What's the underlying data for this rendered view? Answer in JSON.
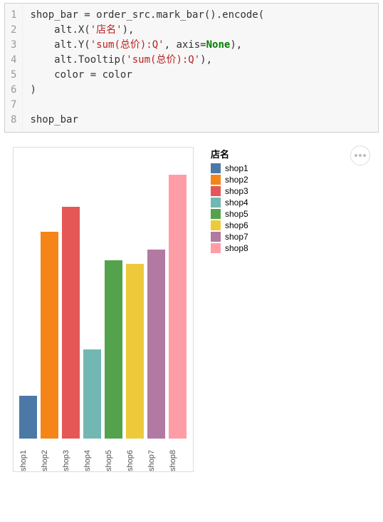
{
  "code": {
    "lines": [
      {
        "n": "1",
        "segs": [
          {
            "t": "shop_bar ",
            "c": "id"
          },
          {
            "t": "=",
            "c": "id"
          },
          {
            "t": " order_src.mark_bar().encode(",
            "c": "id"
          }
        ]
      },
      {
        "n": "2",
        "segs": [
          {
            "t": "    alt.X(",
            "c": "id"
          },
          {
            "t": "'店名'",
            "c": "str"
          },
          {
            "t": "),",
            "c": "id"
          }
        ]
      },
      {
        "n": "3",
        "segs": [
          {
            "t": "    alt.Y(",
            "c": "id"
          },
          {
            "t": "'sum(总价):Q'",
            "c": "str"
          },
          {
            "t": ", axis=",
            "c": "id"
          },
          {
            "t": "None",
            "c": "kw"
          },
          {
            "t": "),",
            "c": "id"
          }
        ]
      },
      {
        "n": "4",
        "segs": [
          {
            "t": "    alt.Tooltip(",
            "c": "id"
          },
          {
            "t": "'sum(总价):Q'",
            "c": "str"
          },
          {
            "t": "),",
            "c": "id"
          }
        ]
      },
      {
        "n": "5",
        "segs": [
          {
            "t": "    color ",
            "c": "id"
          },
          {
            "t": "=",
            "c": "id"
          },
          {
            "t": " color",
            "c": "id"
          }
        ]
      },
      {
        "n": "6",
        "segs": [
          {
            "t": ")",
            "c": "id"
          }
        ]
      },
      {
        "n": "7",
        "segs": [
          {
            "t": "",
            "c": "id"
          }
        ]
      },
      {
        "n": "8",
        "segs": [
          {
            "t": "shop_bar",
            "c": "id"
          }
        ]
      }
    ]
  },
  "chart_data": {
    "type": "bar",
    "legend_title": "店名",
    "categories": [
      "shop1",
      "shop2",
      "shop3",
      "shop4",
      "shop5",
      "shop6",
      "shop7",
      "shop8"
    ],
    "values": [
      60,
      290,
      325,
      125,
      250,
      245,
      265,
      370
    ],
    "colors": [
      "#4c78a8",
      "#f58518",
      "#e45756",
      "#72b7b2",
      "#54a24b",
      "#eeca3b",
      "#b279a2",
      "#ff9da6"
    ],
    "ylim": [
      0,
      400
    ],
    "xlabel": "",
    "ylabel": ""
  },
  "icons": {
    "menu": "more-options"
  }
}
